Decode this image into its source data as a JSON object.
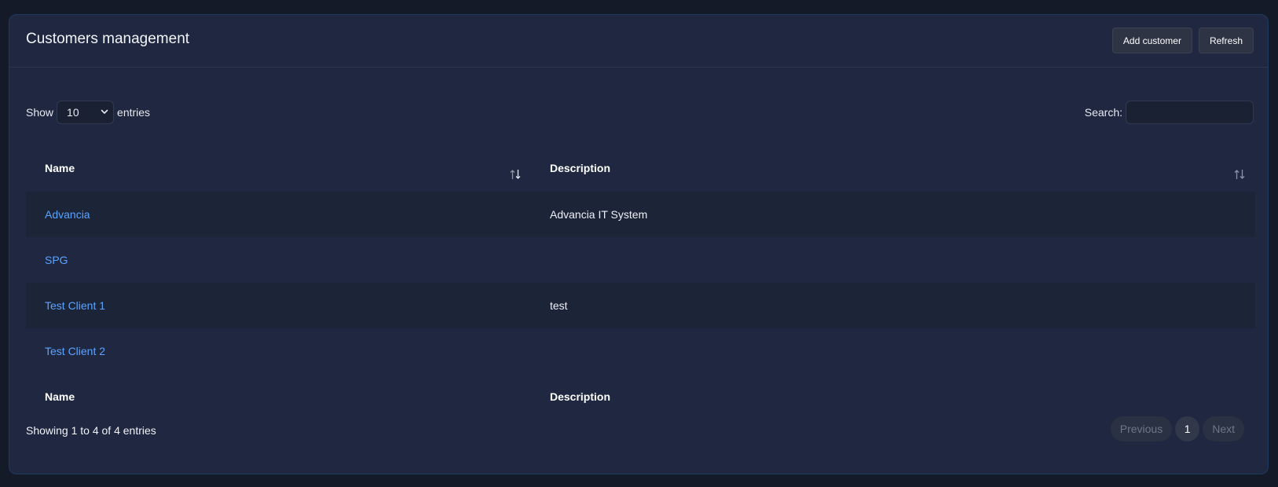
{
  "header": {
    "title": "Customers management",
    "add_label": "Add customer",
    "refresh_label": "Refresh"
  },
  "controls": {
    "show_label": "Show",
    "entries_value": "10",
    "entries_label": "entries",
    "search_label": "Search:",
    "search_value": ""
  },
  "table": {
    "columns": [
      "Name",
      "Description"
    ],
    "rows": [
      {
        "name": "Advancia",
        "description": "Advancia IT System"
      },
      {
        "name": "SPG",
        "description": ""
      },
      {
        "name": "Test Client 1",
        "description": "test"
      },
      {
        "name": "Test Client 2",
        "description": ""
      }
    ],
    "footer_columns": [
      "Name",
      "Description"
    ]
  },
  "footer": {
    "info": "Showing 1 to 4 of 4 entries",
    "previous_label": "Previous",
    "current_page": "1",
    "next_label": "Next"
  },
  "icons": {
    "sort": "sort-arrows-icon",
    "select_chevron": "chevron-down-icon"
  },
  "colors": {
    "background": "#141a28",
    "card": "#1f2840",
    "link": "#5ca3ff",
    "button": "#2e3444"
  }
}
